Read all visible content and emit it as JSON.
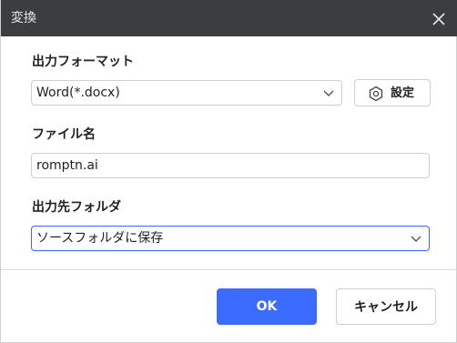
{
  "window": {
    "title": "変換",
    "titlebar_color": "#3b3d40",
    "close_icon": "close-icon"
  },
  "format": {
    "label": "出力フォーマット",
    "selected": "Word(*.docx)",
    "settings_label": "設定",
    "settings_icon": "gear-icon"
  },
  "filename": {
    "label": "ファイル名",
    "value": "romptn.ai"
  },
  "folder": {
    "label": "出力先フォルダ",
    "selected": "ソースフォルダに保存",
    "focus_color": "#3b63ff"
  },
  "footer": {
    "ok_label": "OK",
    "cancel_label": "キャンセル",
    "ok_color": "#3b6cff"
  }
}
